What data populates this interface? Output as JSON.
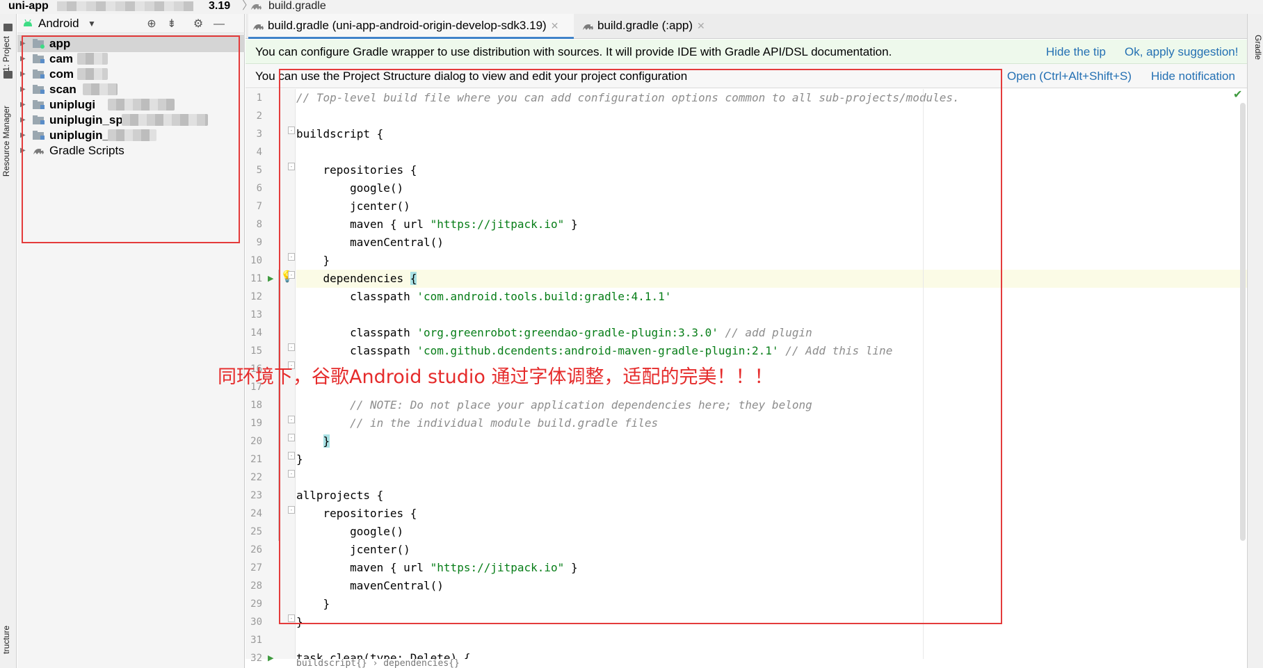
{
  "breadcrumb": {
    "project": "uni-app",
    "version_tail": "3.19",
    "file": "build.gradle"
  },
  "left_strip": {
    "project_tab": "1: Project",
    "resource_tab": "Resource Manager",
    "structure_tab": "tructure"
  },
  "right_strip": {
    "gradle_tab": "Gradle"
  },
  "project_panel": {
    "view_label": "Android",
    "tree": [
      {
        "label": "app",
        "bold": true,
        "selected": true
      },
      {
        "label": "cam",
        "bold": true
      },
      {
        "label": "com",
        "bold": true
      },
      {
        "label": "scan",
        "bold": true
      },
      {
        "label": "uniplugi",
        "bold": true
      },
      {
        "label": "uniplugin_sp",
        "bold": true
      },
      {
        "label": "uniplugin_",
        "bold": true
      },
      {
        "label": "Gradle Scripts",
        "bold": false
      }
    ]
  },
  "tabs": [
    {
      "label": "build.gradle (uni-app-android-origin-develop-sdk3.19)",
      "active": true
    },
    {
      "label": "build.gradle (:app)",
      "active": false
    }
  ],
  "notifications": {
    "gradle_wrapper": {
      "text": "You can configure Gradle wrapper to use distribution with sources. It will provide IDE with Gradle API/DSL documentation.",
      "hide_tip": "Hide the tip",
      "apply": "Ok, apply suggestion!"
    },
    "project_structure": {
      "text": "You can use the Project Structure dialog to view and edit your project configuration",
      "open": "Open (Ctrl+Alt+Shift+S)",
      "hide": "Hide notification"
    }
  },
  "editor": {
    "lines": [
      {
        "n": "1"
      },
      {
        "n": "2"
      },
      {
        "n": "3"
      },
      {
        "n": "4"
      },
      {
        "n": "5"
      },
      {
        "n": "6"
      },
      {
        "n": "7"
      },
      {
        "n": "8"
      },
      {
        "n": "9"
      },
      {
        "n": "10"
      },
      {
        "n": "11"
      },
      {
        "n": "12"
      },
      {
        "n": "13"
      },
      {
        "n": "14"
      },
      {
        "n": "15"
      },
      {
        "n": "16"
      },
      {
        "n": "17"
      },
      {
        "n": "18"
      },
      {
        "n": "19"
      },
      {
        "n": "20"
      },
      {
        "n": "21"
      },
      {
        "n": "22"
      },
      {
        "n": "23"
      },
      {
        "n": "24"
      },
      {
        "n": "25"
      },
      {
        "n": "26"
      },
      {
        "n": "27"
      },
      {
        "n": "28"
      },
      {
        "n": "29"
      },
      {
        "n": "30"
      },
      {
        "n": "31"
      },
      {
        "n": "32"
      }
    ],
    "code": {
      "l1": "// Top-level build file where you can add configuration options common to all sub-projects/modules.",
      "l3": "buildscript {",
      "l5": "    repositories {",
      "l6": "        google()",
      "l7": "        jcenter()",
      "l8_a": "        maven { url ",
      "l8_str": "\"https://jitpack.io\"",
      "l8_b": " }",
      "l9": "        mavenCentral()",
      "l10": "    }",
      "l11_a": "    dependencies ",
      "l11_brace": "{",
      "l12_a": "        classpath ",
      "l12_str": "'com.android.tools.build:gradle:4.1.1'",
      "l14_a": "        classpath ",
      "l14_str": "'org.greenrobot:greendao-gradle-plugin:3.3.0'",
      "l14_com": " // add plugin",
      "l15_a": "        classpath ",
      "l15_str": "'com.github.dcendents:android-maven-gradle-plugin:2.1'",
      "l15_com": " // Add this line",
      "l18": "        // NOTE: Do not place your application dependencies here; they belong",
      "l19": "        // in the individual module build.gradle files",
      "l20_pad": "    ",
      "l20_brace": "}",
      "l21": "}",
      "l23": "allprojects {",
      "l24": "    repositories {",
      "l25": "        google()",
      "l26": "        jcenter()",
      "l27_a": "        maven { url ",
      "l27_str": "\"https://jitpack.io\"",
      "l27_b": " }",
      "l28": "        mavenCentral()",
      "l29": "    }",
      "l30": "}",
      "l32": "task clean(type: Delete) {"
    },
    "footer_crumb": "buildscript{} › dependencies{}"
  },
  "annotation": {
    "text": "同环境下，谷歌Android studio 通过字体调整，适配的完美！！！",
    "color": "#e52b2b"
  },
  "colors": {
    "accent": "#4083c9",
    "link": "#2470b3",
    "string": "#067d17",
    "comment": "#8c8c8c",
    "annotation_red": "#e43b3b"
  }
}
